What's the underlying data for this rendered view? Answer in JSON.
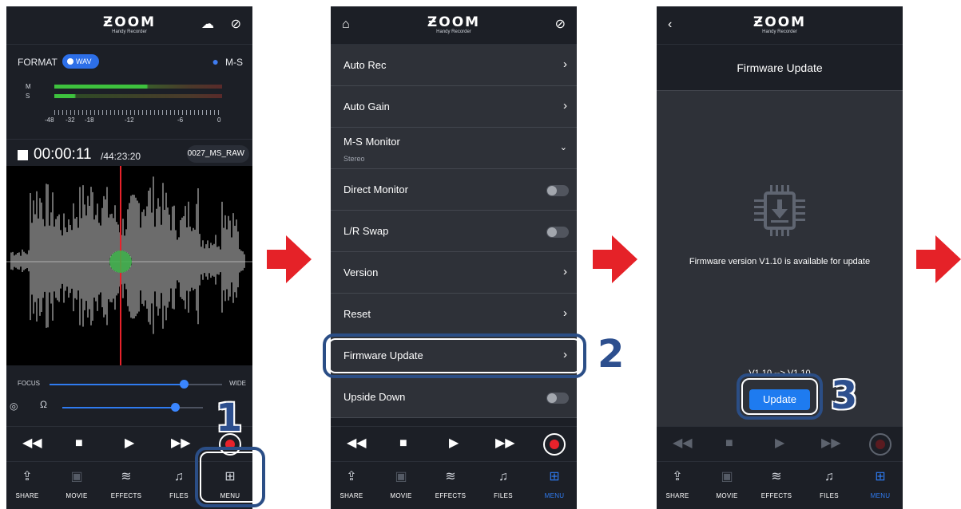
{
  "logo": {
    "word": "ƵOOM",
    "sub": "Handy Recorder"
  },
  "phone1": {
    "format_label": "FORMAT",
    "format_value": "WAV",
    "mic_mode": "M-S",
    "meter_channels": [
      "M",
      "S"
    ],
    "meter_scale": [
      "-48",
      "-32",
      "-18",
      "-12",
      "-6",
      "0"
    ],
    "elapsed": "00:00:11",
    "remaining": "/44:23:20",
    "filename": "0027_MS_RAW",
    "focus_label": "FOCUS",
    "wide_label": "WIDE",
    "focus_level": 0.78,
    "volume_level": 0.8
  },
  "phone2": {
    "items": [
      {
        "label": "Auto Rec",
        "control": "chevron"
      },
      {
        "label": "Auto Gain",
        "control": "chevron"
      },
      {
        "label": "M-S Monitor",
        "sub": "Stereo",
        "control": "dropdown"
      },
      {
        "label": "Direct Monitor",
        "control": "toggle"
      },
      {
        "label": "L/R Swap",
        "control": "toggle"
      },
      {
        "label": "Version",
        "control": "chevron"
      },
      {
        "label": "Reset",
        "control": "chevron"
      },
      {
        "label": "Firmware Update",
        "control": "chevron"
      },
      {
        "label": "Upside Down",
        "control": "toggle"
      }
    ]
  },
  "phone3": {
    "title": "Firmware Update",
    "message": "Firmware version V1.10 is available for update",
    "version_change": "V1.10 --> V1.10",
    "button": "Update"
  },
  "tabs": [
    "SHARE",
    "MOVIE",
    "EFFECTS",
    "FILES",
    "MENU"
  ],
  "steps": [
    "1",
    "2",
    "3"
  ],
  "colors": {
    "accent": "#2f7bf0",
    "record": "#e8222b",
    "callout": "#2b4e86",
    "arrow": "#e52228"
  }
}
